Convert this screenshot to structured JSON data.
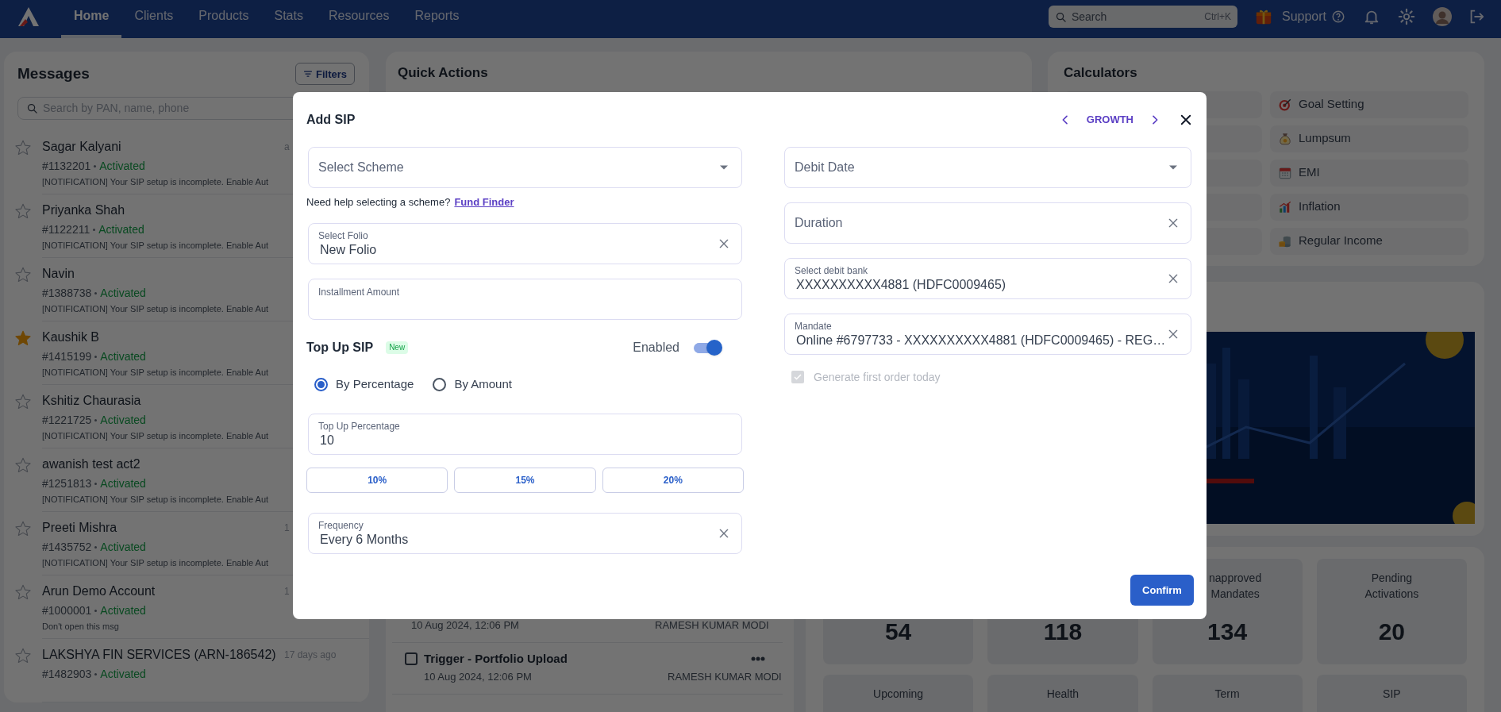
{
  "nav": {
    "tabs": [
      {
        "label": "Home",
        "selected": true
      },
      {
        "label": "Clients",
        "selected": false
      },
      {
        "label": "Products",
        "selected": false
      },
      {
        "label": "Stats",
        "selected": false
      },
      {
        "label": "Resources",
        "selected": false
      },
      {
        "label": "Reports",
        "selected": false
      }
    ],
    "search": {
      "placeholder": "Search",
      "shortcut": "Ctrl+K"
    },
    "support": "Support"
  },
  "messages": {
    "title": "Messages",
    "filters": "Filters",
    "search_placeholder": "Search by PAN, name, phone",
    "items": [
      {
        "name": "Sagar Kalyani",
        "time": "a",
        "id": "#1132201",
        "status": "Activated",
        "preview": "[NOTIFICATION] Your SIP setup is incomplete. Enable Aut",
        "starred": false
      },
      {
        "name": "Priyanka Shah",
        "id": "#1122211",
        "status": "Activated",
        "preview": "[NOTIFICATION] Your SIP setup is incomplete. Enable Aut",
        "starred": false
      },
      {
        "name": "Navin",
        "id": "#1388738",
        "status": "Activated",
        "preview": "[NOTIFICATION] Your SIP setup is incomplete. Enable Aut",
        "starred": false
      },
      {
        "name": "Kaushik B",
        "id": "#1415199",
        "status": "Activated",
        "preview": "[NOTIFICATION] Your SIP setup is incomplete. Enable Aut",
        "starred": true
      },
      {
        "name": "Kshitiz Chaurasia",
        "id": "#1221725",
        "status": "Activated",
        "preview": "[NOTIFICATION] Your SIP setup is incomplete. Enable Aut",
        "starred": false
      },
      {
        "name": "awanish test act2",
        "id": "#1251813",
        "status": "Activated",
        "preview": "[NOTIFICATION] Your SIP setup is incomplete. Enable Aut",
        "starred": false
      },
      {
        "name": "Preeti Mishra",
        "time": "1",
        "id": "#1435752",
        "status": "Activated",
        "preview": "[NOTIFICATION] Your SIP setup is incomplete. Enable Aut",
        "starred": false
      },
      {
        "name": "Arun Demo Account",
        "time": "1",
        "id": "#1000001",
        "status": "Activated",
        "preview": "Don't open this msg",
        "starred": false
      },
      {
        "name": "LAKSHYA FIN SERVICES (ARN-186542)",
        "time": "17 days ago",
        "id": "#1482903",
        "status": "Activated",
        "starred": false
      }
    ]
  },
  "quick_actions": {
    "title": "Quick Actions",
    "tasks": [
      {
        "date": "10 Aug 2024, 12:06 PM",
        "owner": "RAMESH KUMAR MODI"
      },
      {
        "title": "Trigger - Portfolio Upload",
        "checked": false,
        "date": "10 Aug 2024, 12:06 PM",
        "owner": "RAMESH KUMAR MODI"
      }
    ]
  },
  "calculators": {
    "title": "Calculators",
    "items": [
      "Goal Setting",
      "Lumpsum",
      "EMI",
      "Inflation",
      "Regular Income"
    ]
  },
  "stats": [
    {
      "value": "54"
    },
    {
      "value": "118"
    },
    {
      "label": "napproved Mandates",
      "value": "134"
    },
    {
      "label": "Pending Activations",
      "value": "20"
    },
    {
      "label": "Upcoming"
    },
    {
      "label": "Health"
    },
    {
      "label": "Term"
    },
    {
      "label": "SIP"
    }
  ],
  "modal": {
    "title": "Add SIP",
    "plan": "GROWTH",
    "scheme": {
      "placeholder": "Select Scheme"
    },
    "help": {
      "text": "Need help selecting a scheme?",
      "link": "Fund Finder"
    },
    "folio": {
      "label": "Select Folio",
      "value": "New Folio"
    },
    "installment": {
      "label": "Installment Amount"
    },
    "top_up": {
      "title": "Top Up SIP",
      "badge": "New",
      "toggle_label": "Enabled",
      "on": true,
      "modes": [
        {
          "label": "By Percentage",
          "selected": true
        },
        {
          "label": "By Amount",
          "selected": false
        }
      ],
      "field": {
        "label": "Top Up Percentage",
        "value": "10"
      },
      "presets": [
        "10%",
        "15%",
        "20%"
      ],
      "frequency": {
        "label": "Frequency",
        "value": "Every 6 Months"
      }
    },
    "debit_date": {
      "placeholder": "Debit Date"
    },
    "duration": {
      "placeholder": "Duration"
    },
    "bank": {
      "label": "Select debit bank",
      "value": "XXXXXXXXXX4881 (HDFC0009465)"
    },
    "mandate": {
      "label": "Mandate",
      "value": "Online #6797733 - XXXXXXXXXX4881 (HDFC0009465) - REG…"
    },
    "first_order": {
      "label": "Generate first order today",
      "checked": true,
      "disabled": true
    },
    "confirm": "Confirm"
  }
}
